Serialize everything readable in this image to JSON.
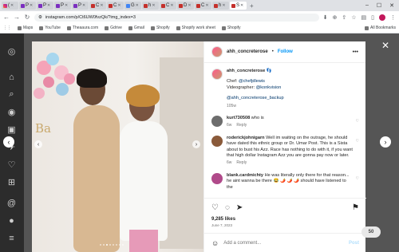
{
  "browser": {
    "tabs": [
      {
        "label": "(",
        "icon": "instagram-icon"
      },
      {
        "label": "P",
        "icon": "page-icon"
      },
      {
        "label": "P",
        "icon": "page-icon"
      },
      {
        "label": "P",
        "icon": "page-icon"
      },
      {
        "label": "P",
        "icon": "page-icon"
      },
      {
        "label": "C",
        "icon": "page-icon"
      },
      {
        "label": "C",
        "icon": "page-icon"
      },
      {
        "label": "G",
        "icon": "google-icon"
      },
      {
        "label": "h",
        "icon": "page-icon"
      },
      {
        "label": "C",
        "icon": "page-icon"
      },
      {
        "label": "D",
        "icon": "page-icon"
      },
      {
        "label": "C",
        "icon": "page-icon"
      },
      {
        "label": "h",
        "icon": "page-icon"
      },
      {
        "label": "S",
        "icon": "page-icon"
      }
    ],
    "active_tab_index": 13,
    "url": "instagram.com/p/Ct6UW0fvzQk/?img_index=3",
    "bookmarks": [
      "Maps",
      "YouTube",
      "Theaaura.com",
      "Gdrive",
      "Gmail",
      "Shopify",
      "Shopify work sheet",
      "Shopify"
    ],
    "all_bookmarks_label": "All Bookmarks"
  },
  "post": {
    "username": "ahh_concreterose",
    "follow_label": "Follow",
    "separator": "•",
    "caption_user": "ahh_concreterose",
    "caption_emoji": "👣",
    "caption_chef_prefix": "Chef: ",
    "caption_chef_handle": "@chefjdlewis",
    "caption_video_prefix": "Videographer: ",
    "caption_video_handle": "@konkvision",
    "caption_backup": "@ahh_concreterose_backup",
    "caption_age": "105w",
    "photo_text": "Ba",
    "likes": "9,285 likes",
    "date": "June 7, 2023",
    "add_comment_placeholder": "Add a comment...",
    "post_label": "Post"
  },
  "comments": [
    {
      "user": "kurt730508",
      "text": "who is",
      "age": "6w",
      "reply": "Reply",
      "avatar_color": "#6d6d6d"
    },
    {
      "user": "roderickjohnigarn",
      "text": "Well im waiting on the outrage, he should have dated this ethnic group or Dr. Umar Post. This is a Sista about to bust his Azz. Race has nothing to do with it, if you want that high dollar Instagram Azz you are gonna pay now or later.",
      "age": "6w",
      "reply": "Reply",
      "avatar_color": "#8a5a3a"
    },
    {
      "user": "blank.cardmichty",
      "text": "He was literally only there for that reason... he aint wanna be there 😂 🌶️ 🌶️ 🌶️ should have listened to the",
      "age": "",
      "reply": "",
      "avatar_color": "#b04a8a"
    }
  ],
  "extension_badge": "50"
}
